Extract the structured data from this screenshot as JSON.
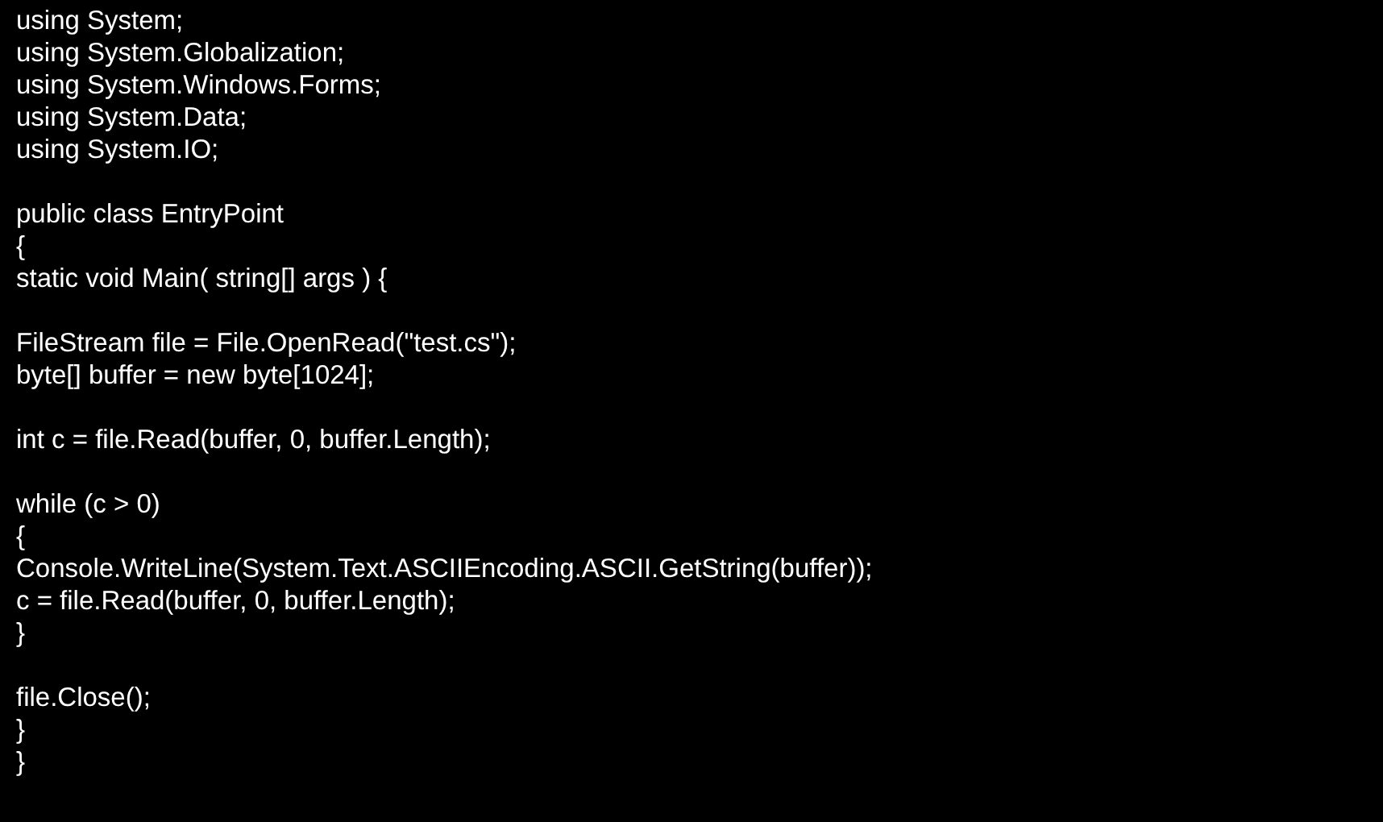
{
  "console": {
    "blocks": [
      [
        "using System;",
        "using System.Globalization;",
        "using System.Windows.Forms;",
        "using System.Data;",
        "using System.IO;"
      ],
      [
        "public class EntryPoint",
        "{",
        "static void Main( string[] args ) {"
      ],
      [
        "FileStream file = File.OpenRead(\"test.cs\");",
        "byte[] buffer = new byte[1024];"
      ],
      [
        "int c = file.Read(buffer, 0, buffer.Length);"
      ],
      [
        "while (c > 0)",
        "{",
        "Console.WriteLine(System.Text.ASCIIEncoding.ASCII.GetString(buffer));",
        "c = file.Read(buffer, 0, buffer.Length);",
        "}"
      ],
      [
        "file.Close();",
        "}",
        "}"
      ]
    ]
  }
}
